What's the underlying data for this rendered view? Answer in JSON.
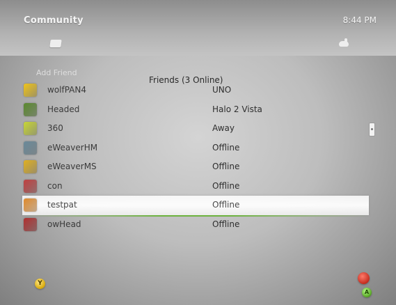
{
  "header": {
    "title": "Community",
    "time": "8:44 PM"
  },
  "list_title": "Friends (3 Online)",
  "section_label": "Add Friend",
  "friends": [
    {
      "name": "wolfPAN4",
      "status": "UNO",
      "avatar_color": "#f0c419"
    },
    {
      "name": "Headed",
      "status": "Halo 2 Vista",
      "avatar_color": "#5b8a2e"
    },
    {
      "name": "360",
      "status": "Away",
      "avatar_color": "#c8d634"
    },
    {
      "name": "eWeaverHM",
      "status": "Offline",
      "avatar_color": "#6a8a9a"
    },
    {
      "name": "eWeaverMS",
      "status": "Offline",
      "avatar_color": "#e0b020"
    },
    {
      "name": "con",
      "status": "Offline",
      "avatar_color": "#c04040"
    },
    {
      "name": "testpat",
      "status": "Offline",
      "avatar_color": "#e08a2a"
    },
    {
      "name": "owHead",
      "status": "Offline",
      "avatar_color": "#b03030"
    }
  ],
  "selected_index": 6,
  "footer": {
    "y_label": "Y",
    "a_label": "A"
  },
  "icons": {
    "left_nav": "message-icon",
    "right_nav": "controller-icon"
  }
}
